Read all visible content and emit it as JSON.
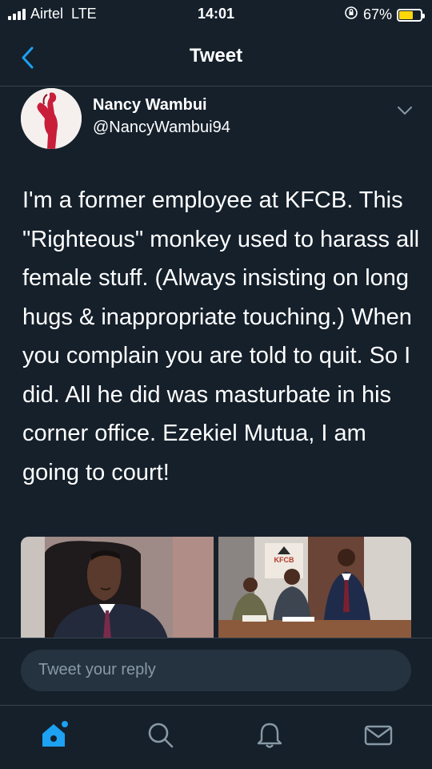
{
  "status_bar": {
    "carrier": "Airtel",
    "network": "LTE",
    "time": "14:01",
    "battery_percent": "67%",
    "battery_level": 0.67,
    "battery_color": "#ffd60a"
  },
  "nav": {
    "back_icon": "chevron-left-icon",
    "title": "Tweet"
  },
  "tweet": {
    "author_name": "Nancy Wambui",
    "author_handle": "@NancyWambui94",
    "text": "I'm a former employee at KFCB. This \"Righteous\" monkey used to harass all female stuff. (Always insisting on long hugs & inappropriate touching.) When you complain you are told to quit. So I did. All he did was masturbate in his corner office. Ezekiel Mutua, I am going to court!",
    "media_sign_text": "KFCB"
  },
  "reply": {
    "placeholder": "Tweet your reply"
  },
  "tabs": [
    {
      "name": "home",
      "icon": "home-icon",
      "active": true
    },
    {
      "name": "search",
      "icon": "search-icon",
      "active": false
    },
    {
      "name": "notifications",
      "icon": "bell-icon",
      "active": false
    },
    {
      "name": "messages",
      "icon": "mail-icon",
      "active": false
    }
  ],
  "colors": {
    "background": "#15202b",
    "accent": "#1da1f2",
    "secondary_text": "#8899a6",
    "divider": "#38444d"
  }
}
